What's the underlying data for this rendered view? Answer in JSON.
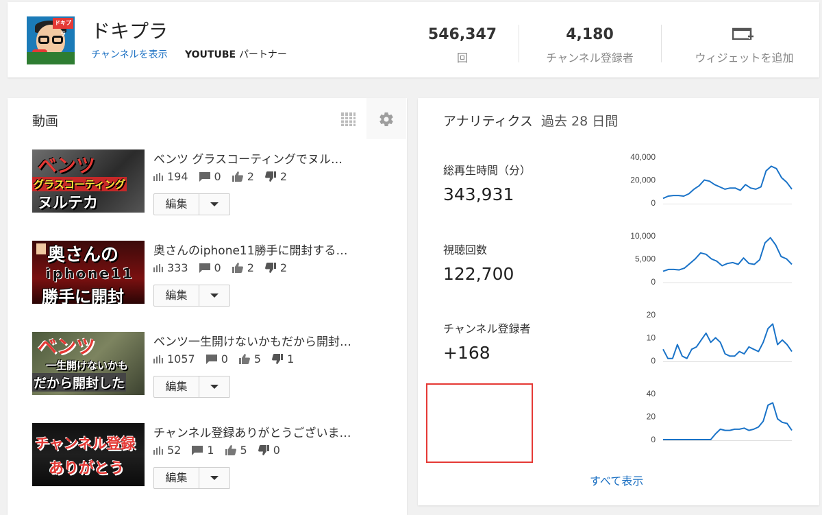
{
  "channel": {
    "name": "ドキプラ",
    "view_channel_link": "チャンネルを表示",
    "partner_label": "YOUTUBE",
    "partner_suffix": "パートナー",
    "avatar_tag": "ドキプラ"
  },
  "stats": {
    "views": {
      "value": "546,347",
      "label": "回"
    },
    "subscribers": {
      "value": "4,180",
      "label": "チャンネル登録者"
    },
    "add_widget": {
      "label": "ウィジェットを追加",
      "icon": "add-widget-icon"
    }
  },
  "videos_panel": {
    "title": "動画",
    "edit_label": "編集",
    "items": [
      {
        "title": "ベンツ グラスコーティングでヌル…",
        "views": "194",
        "comments": "0",
        "likes": "2",
        "dislikes": "2",
        "thumb": {
          "line1": "ベンツ",
          "line2": "グラスコーティング",
          "line3": "ヌルテカ"
        }
      },
      {
        "title": "奥さんのiphone11勝手に開封する…",
        "views": "333",
        "comments": "0",
        "likes": "2",
        "dislikes": "2",
        "thumb": {
          "line1": "奥さんの",
          "line2": "iphone11",
          "line3": "勝手に開封"
        }
      },
      {
        "title": "ベンツ一生開けないかもだから開封…",
        "views": "1057",
        "comments": "0",
        "likes": "5",
        "dislikes": "1",
        "thumb": {
          "line1": "ベンツ",
          "line2": "一生開けないかも",
          "line3": "だから開封した"
        }
      },
      {
        "title": "チャンネル登録ありがとうございま…",
        "views": "52",
        "comments": "1",
        "likes": "5",
        "dislikes": "0",
        "thumb": {
          "line1": "チャンネル登録",
          "line2": "ありがとう",
          "line3": ""
        }
      }
    ]
  },
  "analytics": {
    "title": "アナリティクス",
    "period": "過去 28 日間",
    "see_all": "すべて表示",
    "accent_color": "#1a73c8",
    "metrics": [
      {
        "label": "総再生時間（分）",
        "value": "343,931"
      },
      {
        "label": "視聴回数",
        "value": "122,700"
      },
      {
        "label": "チャンネル登録者",
        "value": "+168"
      },
      {
        "label": "",
        "value": ""
      }
    ]
  },
  "chart_data": [
    {
      "type": "line",
      "yticks": [
        "40,000",
        "20,000",
        "0"
      ],
      "ylim": [
        0,
        40000
      ],
      "values": [
        4000,
        6000,
        6500,
        6500,
        6000,
        8000,
        12000,
        15000,
        20000,
        19000,
        16000,
        14000,
        12000,
        13000,
        13000,
        11000,
        16000,
        13000,
        12000,
        14000,
        28000,
        32000,
        30000,
        22000,
        18000,
        12000
      ]
    },
    {
      "type": "line",
      "yticks": [
        "10,000",
        "5,000",
        "0"
      ],
      "ylim": [
        0,
        10000
      ],
      "values": [
        2300,
        2700,
        2700,
        2600,
        3000,
        4000,
        5000,
        6300,
        6000,
        5000,
        4500,
        3500,
        4000,
        4200,
        3800,
        5200,
        4000,
        3800,
        4800,
        8500,
        9600,
        8000,
        5500,
        5000,
        3800
      ]
    },
    {
      "type": "line",
      "yticks": [
        "20",
        "10",
        "0"
      ],
      "ylim": [
        0,
        20
      ],
      "values": [
        5,
        1,
        1,
        7,
        2,
        1,
        5,
        6,
        9,
        12,
        8,
        10,
        8,
        3,
        2,
        2,
        4,
        3,
        6,
        5,
        4,
        8,
        14,
        16,
        7,
        9,
        7,
        4
      ]
    },
    {
      "type": "line",
      "yticks": [
        "40",
        "20",
        "0"
      ],
      "ylim": [
        0,
        40
      ],
      "values": [
        0,
        0,
        0,
        0,
        0,
        0,
        0,
        0,
        0,
        0,
        0,
        5,
        9,
        8,
        8,
        9,
        9,
        10,
        8,
        9,
        11,
        16,
        30,
        32,
        18,
        15,
        14,
        8
      ]
    }
  ]
}
